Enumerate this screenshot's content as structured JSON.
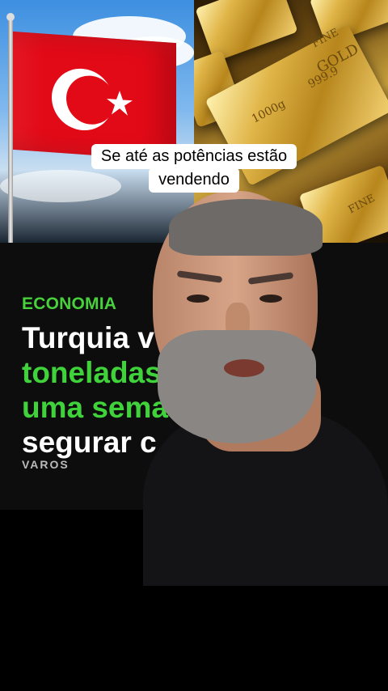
{
  "caption": {
    "line1": "Se até as potências estão",
    "line2": "vendendo"
  },
  "article": {
    "tag": "ECONOMIA",
    "headline_line1": "Turquia v",
    "headline_line2": "toneladas",
    "headline_line3": "uma sema",
    "headline_line4": "segurar c",
    "brand": "VAROS"
  },
  "gold_bar": {
    "text1": "FINE",
    "text2": "GOLD",
    "text3": "999.9",
    "text4": "1000g",
    "text5": "FINE"
  },
  "colors": {
    "flag_red": "#e30a17",
    "tag_green": "#47d13b",
    "headline_green": "#3fd23a"
  }
}
